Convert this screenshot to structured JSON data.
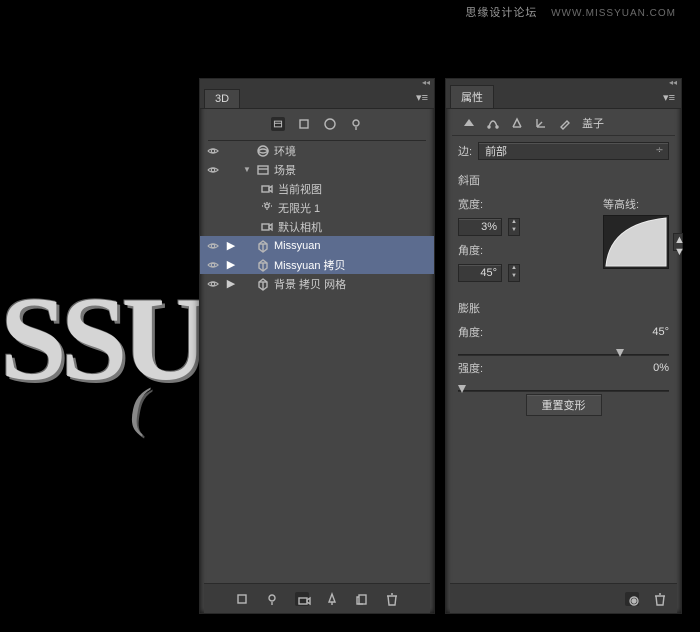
{
  "watermark": {
    "text": "思缘设计论坛",
    "url_text": "WWW.MISSYUAN.COM"
  },
  "bg_text": {
    "line1": "SSU",
    "line2": "("
  },
  "panel_3d": {
    "tab": "3D",
    "tree": [
      {
        "vis": "eye",
        "tog": "",
        "arrow": "",
        "icon": "env",
        "label": "环境",
        "indent": 1,
        "sel": false
      },
      {
        "vis": "eye",
        "tog": "",
        "arrow": "▼",
        "icon": "scene",
        "label": "场景",
        "indent": 1,
        "sel": false
      },
      {
        "vis": "",
        "tog": "",
        "arrow": "",
        "icon": "camera",
        "label": "当前视图",
        "indent": 2,
        "sel": false
      },
      {
        "vis": "",
        "tog": "",
        "arrow": "",
        "icon": "light",
        "label": "无限光 1",
        "indent": 2,
        "sel": false
      },
      {
        "vis": "",
        "tog": "",
        "arrow": "",
        "icon": "camera",
        "label": "默认相机",
        "indent": 2,
        "sel": false
      },
      {
        "vis": "eye",
        "tog": "▶",
        "arrow": "",
        "icon": "mesh",
        "label": "Missyuan",
        "indent": 1,
        "sel": true
      },
      {
        "vis": "eye",
        "tog": "▶",
        "arrow": "",
        "icon": "mesh",
        "label": "Missyuan 拷贝",
        "indent": 1,
        "sel": true
      },
      {
        "vis": "eye",
        "tog": "▶",
        "arrow": "",
        "icon": "mesh",
        "label": "背景 拷贝 网格",
        "indent": 1,
        "sel": false
      }
    ]
  },
  "panel_props": {
    "tab": "属性",
    "crumb": "盖子",
    "edge_label": "边:",
    "edge_value": "前部",
    "bevel_section": "斜面",
    "width_label": "宽度:",
    "width_value": "3%",
    "angle_label": "角度:",
    "angle_value": "45°",
    "contour_label": "等高线:",
    "inflate_section": "膨胀",
    "inflate_angle_label": "角度:",
    "inflate_angle_value": "45°",
    "strength_label": "强度:",
    "strength_value": "0%",
    "reset_btn": "重置变形"
  }
}
